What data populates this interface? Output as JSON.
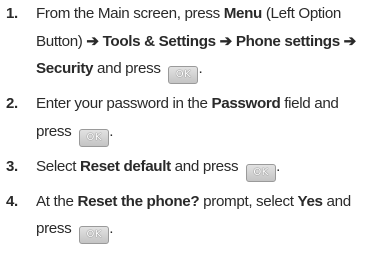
{
  "steps": [
    {
      "number": "1.",
      "segments": [
        {
          "t": "From the Main screen, press "
        },
        {
          "t": "Menu",
          "b": true
        },
        {
          "t": " (Left Option Button) "
        },
        {
          "t": "➔ Tools & Settings ➔ Phone settings ➔ Security",
          "b": true
        },
        {
          "t": " and press "
        },
        {
          "key": "OK"
        },
        {
          "t": "."
        }
      ]
    },
    {
      "number": "2.",
      "segments": [
        {
          "t": "Enter your password in the "
        },
        {
          "t": "Password",
          "b": true
        },
        {
          "t": " field and press "
        },
        {
          "key": "OK"
        },
        {
          "t": "."
        }
      ]
    },
    {
      "number": "3.",
      "segments": [
        {
          "t": "Select "
        },
        {
          "t": "Reset default",
          "b": true
        },
        {
          "t": " and press "
        },
        {
          "key": "OK"
        },
        {
          "t": "."
        }
      ]
    },
    {
      "number": "4.",
      "segments": [
        {
          "t": "At the "
        },
        {
          "t": "Reset the phone?",
          "b": true
        },
        {
          "t": " prompt, select "
        },
        {
          "t": "Yes",
          "b": true
        },
        {
          "t": " and press "
        },
        {
          "key": "OK"
        },
        {
          "t": "."
        }
      ]
    }
  ]
}
